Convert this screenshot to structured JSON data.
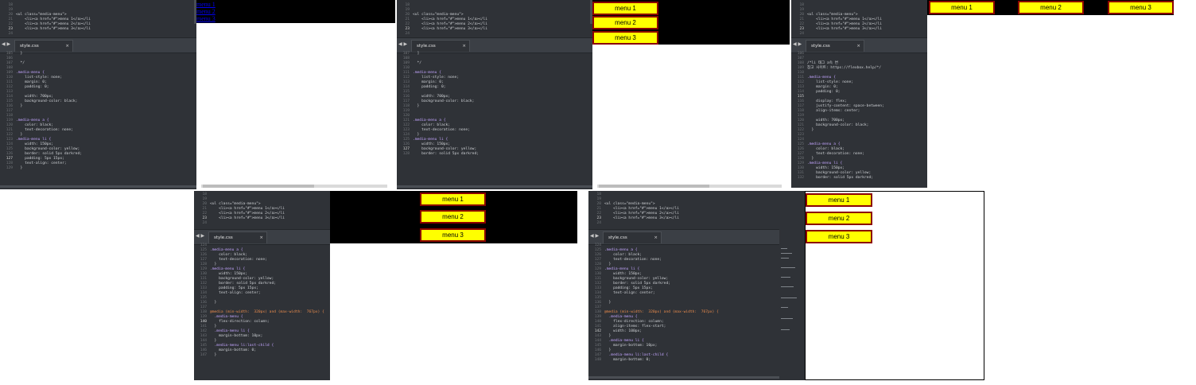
{
  "tab_label": "style.css",
  "tab_close": "×",
  "tab_arrows": "◀ ▶",
  "html_snippet": {
    "numbers": [
      "18",
      "19",
      "20",
      "21",
      "22",
      "23",
      "24"
    ],
    "lines": [
      "",
      "",
      "<ul class=\"media-menu\">",
      "    <li><a href=\"#\">menu 1</a></li",
      "    <li><a href=\"#\">menu 2</a></li",
      "    <li><a href=\"#\">menu 3</a></li",
      ""
    ]
  },
  "menu_labels": [
    "menu 1",
    "menu 2",
    "menu 3"
  ],
  "panels": [
    {
      "css_numbers": [
        "105",
        "106",
        "107",
        "108",
        "109",
        "110",
        "111",
        "112",
        "113",
        "114",
        "115",
        "116",
        "117",
        "118",
        "119",
        "120",
        "121",
        "122",
        "123",
        "124",
        "125",
        "126",
        "127",
        "128",
        "129"
      ],
      "css_lines": [
        "  }",
        "",
        "  */",
        "",
        ".media-menu {",
        "    list-style: none;",
        "    margin: 0;",
        "    padding: 0;",
        "",
        "    width: 700px;",
        "    background-color: black;",
        "  }",
        "",
        "",
        ".media-menu a {",
        "    color: black;",
        "    text-decoration: none;",
        "  }",
        ".media-menu li {",
        "    width: 150px;",
        "    background-color: yellow;",
        "    border: solid 5px darkred;",
        "    padding: 5px 15px;",
        "    text-align: center;",
        "  }"
      ]
    },
    {
      "css_numbers": [
        "107",
        "108",
        "109",
        "110",
        "111",
        "112",
        "113",
        "114",
        "115",
        "116",
        "117",
        "118",
        "119",
        "120",
        "121",
        "122",
        "123",
        "124",
        "125",
        "126",
        "127",
        "128"
      ],
      "css_lines": [
        "  ]",
        "",
        "  */",
        "",
        ".media-menu {",
        "    list-style: none;",
        "    margin: 0;",
        "    padding: 0;",
        "",
        "    width: 700px;",
        "    background-color: black;",
        "  }",
        "",
        "",
        ".media-menu a {",
        "    color: black;",
        "    text-decoration: none;",
        "  }",
        ".media-menu li {",
        "    width: 150px;",
        "    background-color: yellow;",
        "    border: solid 5px darkred;"
      ]
    },
    {
      "css_numbers": [
        "106",
        "107",
        "108",
        "109",
        "110",
        "111",
        "112",
        "113",
        "114",
        "115",
        "116",
        "117",
        "118",
        "119",
        "120",
        "121",
        "122",
        "123",
        "124",
        "125",
        "126",
        "127",
        "128",
        "129",
        "130",
        "131",
        "132"
      ],
      "css_lines": [
        "",
        "",
        "/*li 태그 a속 변",
        "참고 사이트: https://flexbox.help/*/",
        "",
        ".media-menu {",
        "    list-style: none;",
        "    margin: 0;",
        "    padding: 0;",
        "",
        "    display: flex;",
        "    justify-content: space-between;",
        "    align-items: center;",
        "",
        "    width: 700px;",
        "    background-color: black;",
        "  }",
        "",
        "",
        ".media-menu a {",
        "    color: black;",
        "    text-decoration: none;",
        "  }",
        ".media-menu li {",
        "    width: 150px;",
        "    background-color: yellow;",
        "    border: solid 5px darkred;"
      ]
    },
    {
      "css_numbers": [
        "124",
        "125",
        "126",
        "127",
        "128",
        "129",
        "130",
        "131",
        "132",
        "133",
        "134",
        "135",
        "136",
        "137",
        "138",
        "139",
        "140",
        "141",
        "142",
        "143",
        "144",
        "145",
        "146",
        "147"
      ],
      "css_lines": [
        "",
        ".media-menu a {",
        "    color: black;",
        "    text-decoration: none;",
        "  }",
        ".media-menu li {",
        "    width: 150px;",
        "    background-color: yellow;",
        "    border: solid 5px darkred;",
        "    padding: 5px 15px;",
        "    text-align: center;",
        "",
        "  }",
        "",
        "@media (min-width:  320px) and (max-width:  767px) {",
        "  .media-menu {",
        "    flex-direction: column;",
        "  }",
        "  .media-menu li {",
        "    margin-bottom: 10px;",
        "  }",
        "  .media-menu li:last-child {",
        "    margin-bottom: 0;",
        "  }"
      ]
    },
    {
      "css_numbers": [
        "124",
        "125",
        "126",
        "127",
        "128",
        "129",
        "130",
        "131",
        "132",
        "133",
        "134",
        "135",
        "136",
        "137",
        "138",
        "139",
        "140",
        "141",
        "142",
        "143",
        "144",
        "145",
        "146",
        "147",
        "148"
      ],
      "css_lines": [
        "",
        ".media-menu a {",
        "    color: black;",
        "    text-decoration: none;",
        "  }",
        ".media-menu li {",
        "    width: 150px;",
        "    background-color: yellow;",
        "    border: solid 5px darkred;",
        "    padding: 5px 15px;",
        "    text-align: center;",
        "",
        "  }",
        "",
        "@media (min-width:  320px) and (max-width:  767px) {",
        "  .media-menu {",
        "    flex-direction: column;",
        "    align-items: flex-start;",
        "    width: 100px;",
        "  }",
        "  .media-menu li {",
        "    margin-bottom: 10px;",
        "  }",
        "  .media-menu li:last-child {",
        "    margin-bottom: 0;"
      ]
    }
  ],
  "colors": {
    "editor_bg": "#2f3237",
    "menu_bg": "#ffff00",
    "menu_border": "#8b0000",
    "link": "#0000ee"
  }
}
